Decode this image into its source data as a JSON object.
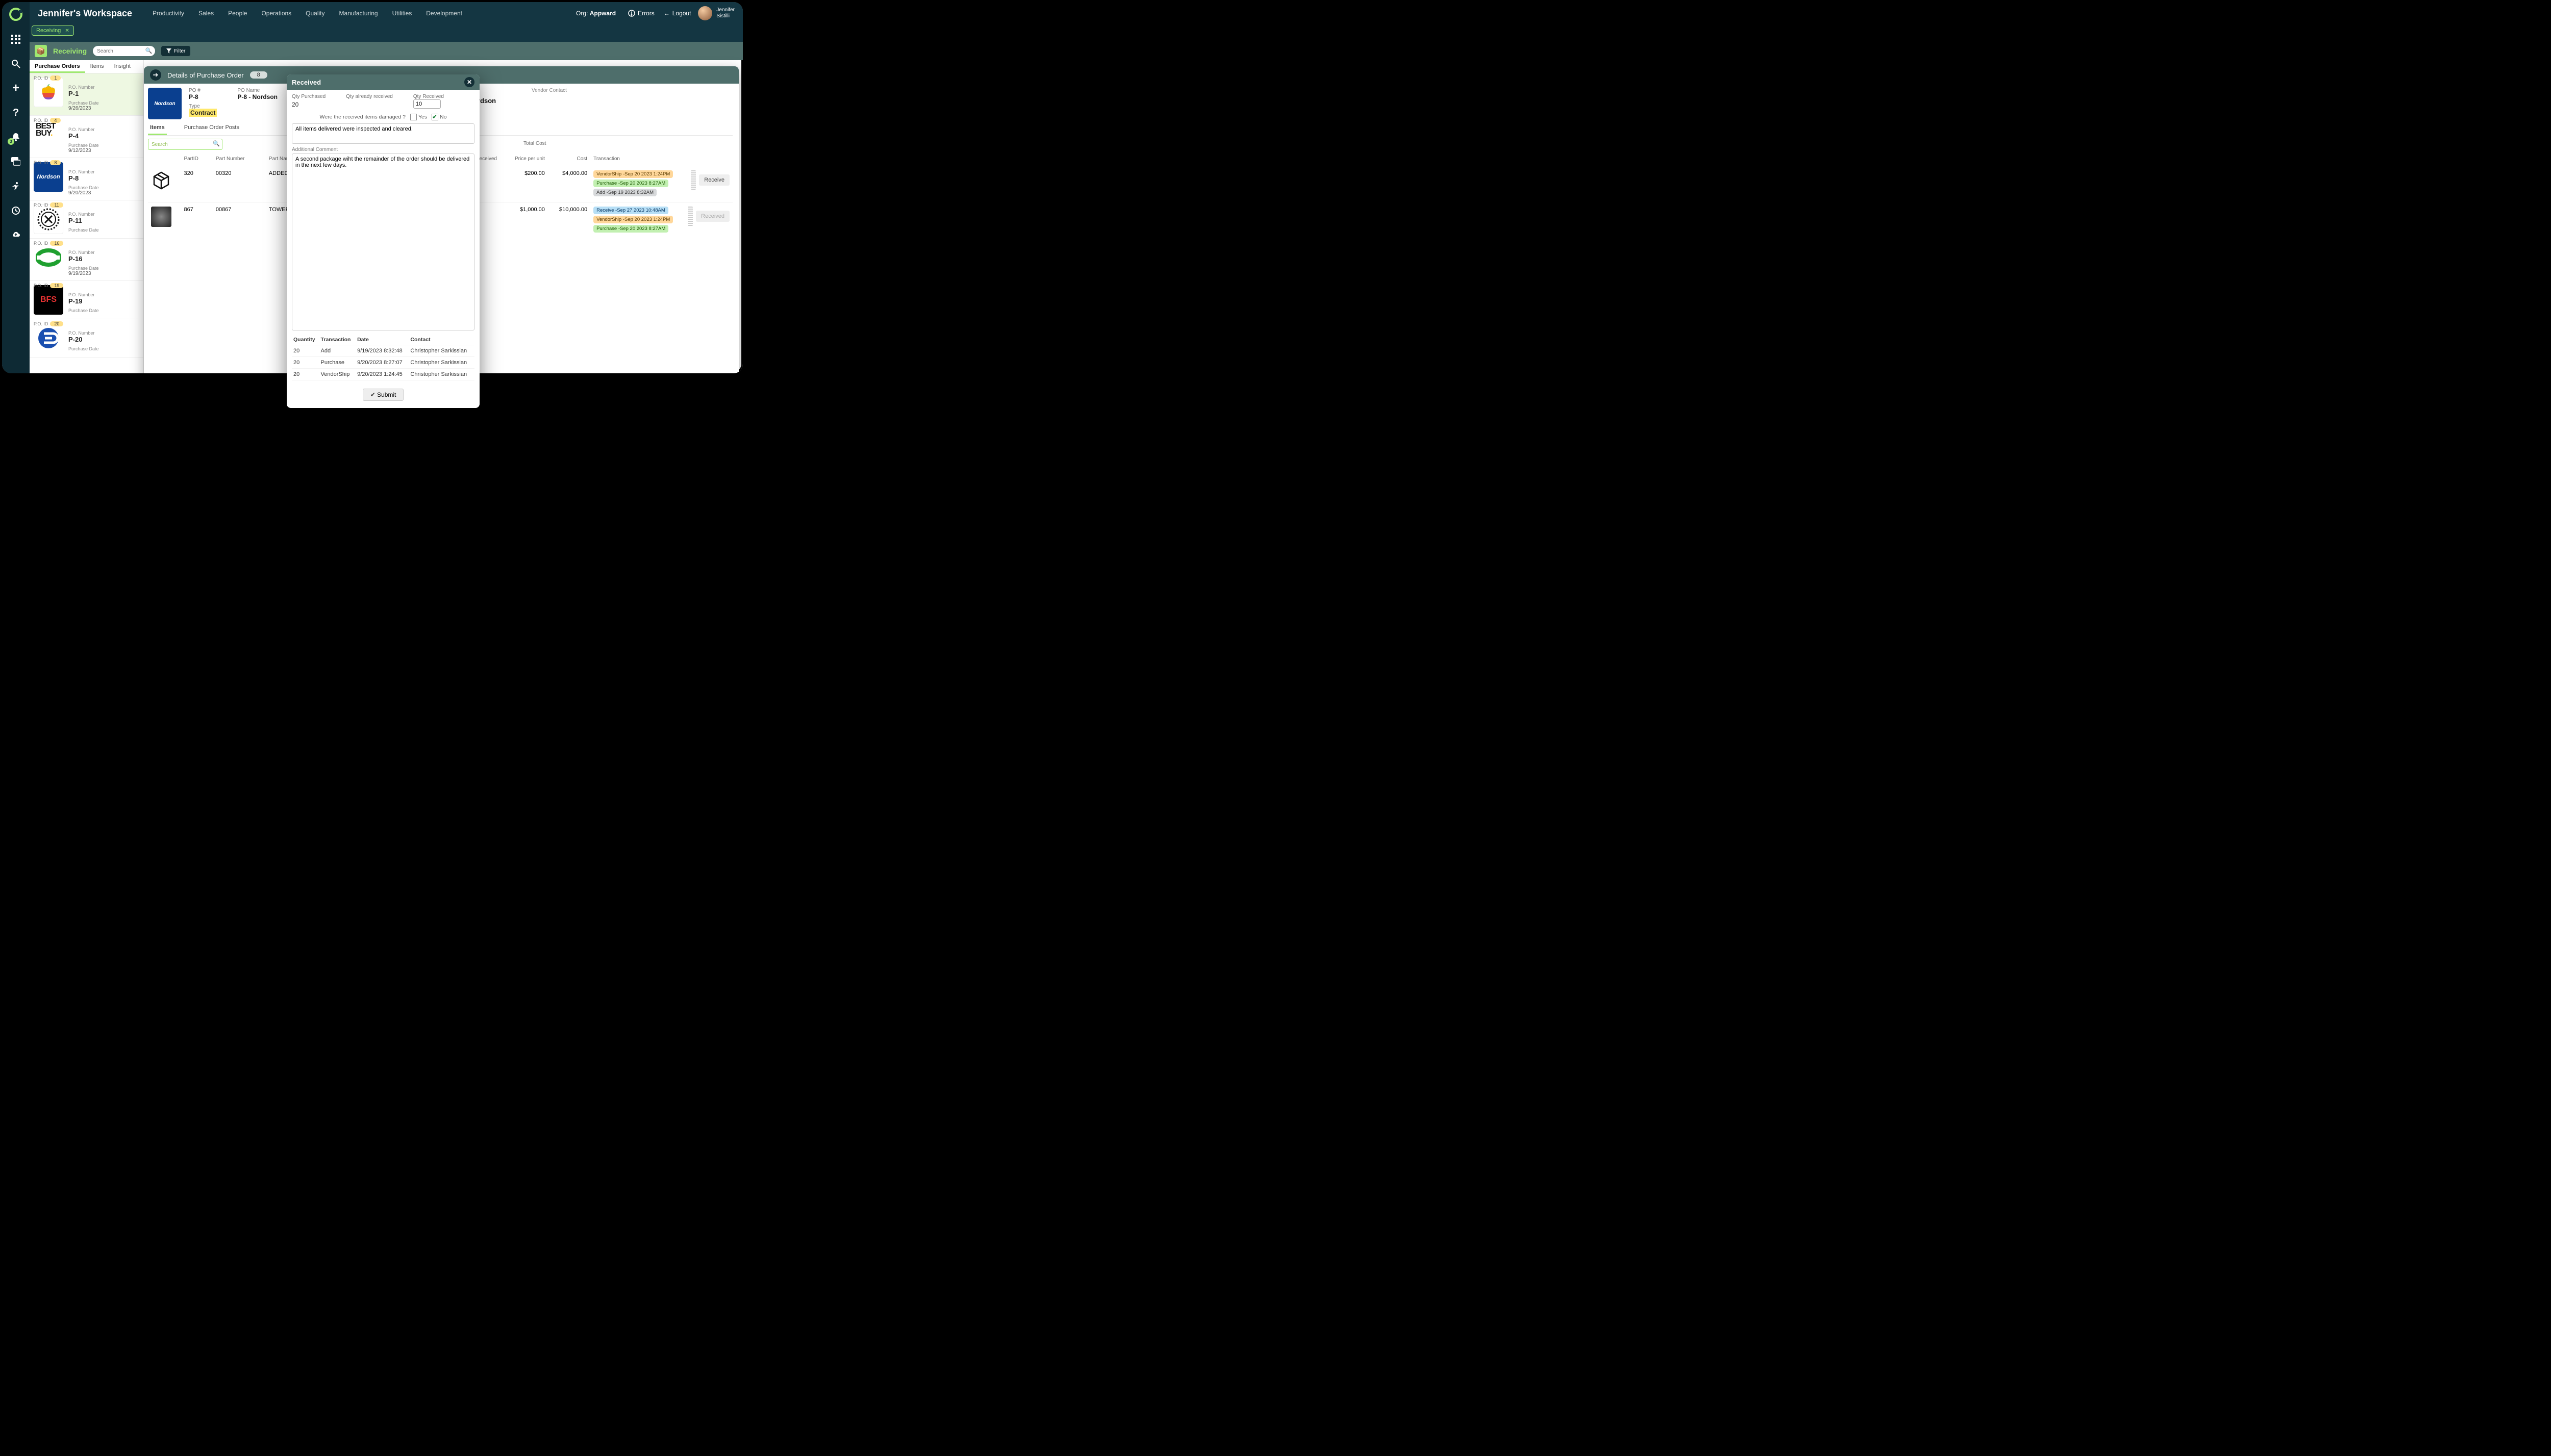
{
  "topnav": {
    "workspace": "Jennifer's Workspace",
    "links": [
      "Productivity",
      "Sales",
      "People",
      "Operations",
      "Quality",
      "Manufacturing",
      "Utilities",
      "Development"
    ],
    "org_label": "Org:",
    "org_value": "Appward",
    "errors": "Errors",
    "logout": "Logout",
    "user_first": "Jennifer",
    "user_last": "Sistilli",
    "chip": "Receiving"
  },
  "rail": {
    "notif_count": "3"
  },
  "subhead": {
    "title": "Receiving",
    "search_placeholder": "Search",
    "filter": "Filter"
  },
  "tabs": {
    "t1": "Purchase Orders",
    "t2": "Items",
    "t3": "Insight"
  },
  "po_list": [
    {
      "id": "1",
      "num": "P-1",
      "date_lbl": "Purchase Date",
      "date": "9/26/2023",
      "logo": "apple",
      "sel": true
    },
    {
      "id": "4",
      "num": "P-4",
      "date_lbl": "Purchase Date",
      "date": "9/12/2023",
      "logo": "bestbuy",
      "sel": false
    },
    {
      "id": "8",
      "num": "P-8",
      "date_lbl": "Purchase Date",
      "date": "9/20/2023",
      "logo": "nordson",
      "sel": false
    },
    {
      "id": "11",
      "num": "P-11",
      "date_lbl": "Purchase Date",
      "date": "",
      "logo": "tool",
      "sel": false
    },
    {
      "id": "16",
      "num": "P-16",
      "date_lbl": "Purchase Date",
      "date": "9/19/2023",
      "logo": "green",
      "sel": false
    },
    {
      "id": "19",
      "num": "P-19",
      "date_lbl": "Purchase Date",
      "date": "",
      "logo": "bfs",
      "sel": false
    },
    {
      "id": "20",
      "num": "P-20",
      "date_lbl": "Purchase Date",
      "date": "",
      "logo": "ce",
      "sel": false
    }
  ],
  "po_labels": {
    "id": "P.O. ID",
    "num": "P.O. Number"
  },
  "detail": {
    "title": "Details of Purchase Order",
    "pill": "8",
    "po_lbl": "PO #",
    "po_val": "P-8",
    "poname_lbl": "PO Name",
    "poname_val": "P-8 - Nordson",
    "type_lbl": "Type",
    "type_val": "Contract",
    "vcontact_lbl": "Vendor Contact",
    "vname_frag": "rdson",
    "tabs": {
      "items": "Items",
      "posts": "Purchase Order Posts"
    },
    "search_placeholder": "Search",
    "headers": {
      "partid": "PartID",
      "partnum": "Part Number",
      "partname": "Part Name",
      "received": "Received",
      "ppu": "Price per unit",
      "cost": "Cost",
      "txn": "Transaction",
      "tcost": "Total Cost"
    },
    "rows": [
      {
        "partid": "320",
        "partnum": "00320",
        "partname": "ADDED O",
        "ppu": "$200.00",
        "cost": "$4,000.00",
        "tags": [
          {
            "cls": "orange",
            "t": "VendorShip -Sep 20 2023 1:24PM"
          },
          {
            "cls": "green",
            "t": "Purchase -Sep 20 2023 8:27AM"
          },
          {
            "cls": "gray",
            "t": "Add -Sep 19 2023 8:32AM"
          }
        ],
        "btn": "Receive",
        "btn_dis": false,
        "icon": "box"
      },
      {
        "partid": "867",
        "partnum": "00867",
        "partname": "TOWER, C",
        "ppu": "$1,000.00",
        "cost": "$10,000.00",
        "tags": [
          {
            "cls": "blue",
            "t": "Receive -Sep 27 2023 10:48AM"
          },
          {
            "cls": "orange",
            "t": "VendorShip -Sep 20 2023 1:24PM"
          },
          {
            "cls": "green",
            "t": "Purchase -Sep 20 2023 8:27AM"
          }
        ],
        "btn": "Received",
        "btn_dis": true,
        "icon": "img"
      }
    ]
  },
  "modal": {
    "title": "Received",
    "qp_lbl": "Qty Purchased",
    "qp_val": "20",
    "qa_lbl": "Qty already received",
    "qa_val": "",
    "qr_lbl": "Qty Received",
    "qr_val": "10",
    "damaged_q": "Were the received items damaged ?",
    "yes": "Yes",
    "no": "No",
    "note": "All items delivered were inspected and cleared.",
    "addcmt_lbl": "Additional Comment",
    "addcmt": "A second package wiht the remainder of the order should be delivered in the next few days.",
    "hist_headers": {
      "q": "Quantity",
      "t": "Transaction",
      "d": "Date",
      "c": "Contact"
    },
    "hist": [
      {
        "q": "20",
        "t": "Add",
        "d": "9/19/2023 8:32:48",
        "c": "Christopher Sarkissian"
      },
      {
        "q": "20",
        "t": "Purchase",
        "d": "9/20/2023 8:27:07",
        "c": "Christopher Sarkissian"
      },
      {
        "q": "20",
        "t": "VendorShip",
        "d": "9/20/2023 1:24:45",
        "c": "Christopher Sarkissian"
      }
    ],
    "submit": "Submit"
  }
}
